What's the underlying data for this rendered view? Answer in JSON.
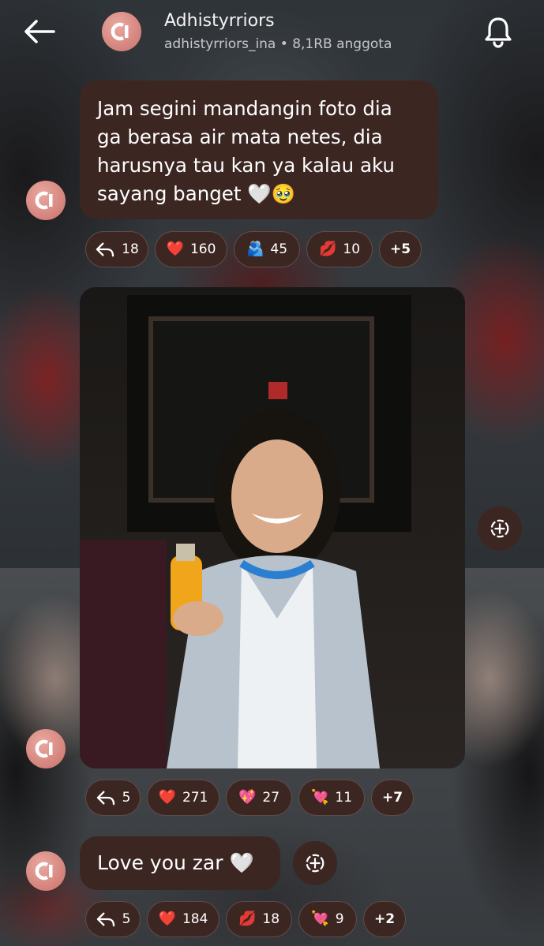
{
  "header": {
    "back_icon": "arrow-left-icon",
    "group_name": "Adhistyrriors",
    "group_meta": "adhistyrriors_ina • 8,1RB anggota",
    "bell_icon": "bell-icon"
  },
  "messages": [
    {
      "text": "Jam segini mandangin foto dia ga berasa air mata netes, dia harusnya tau kan ya kalau aku sayang banget 🤍🥹",
      "reactions": [
        {
          "icon": "reply-icon",
          "count": "18"
        },
        {
          "emoji": "❤️",
          "count": "160"
        },
        {
          "emoji": "🫂",
          "count": "45"
        },
        {
          "emoji": "💋",
          "count": "10"
        }
      ],
      "more": "+5"
    },
    {
      "type": "photo",
      "reactions": [
        {
          "icon": "reply-icon",
          "count": "5"
        },
        {
          "emoji": "❤️",
          "count": "271"
        },
        {
          "emoji": "💖",
          "count": "27"
        },
        {
          "emoji": "💘",
          "count": "11"
        }
      ],
      "more": "+7"
    },
    {
      "text": "Love you zar 🤍",
      "reactions": [
        {
          "icon": "reply-icon",
          "count": "5"
        },
        {
          "emoji": "❤️",
          "count": "184"
        },
        {
          "emoji": "💋",
          "count": "18"
        },
        {
          "emoji": "💘",
          "count": "9"
        }
      ],
      "more": "+2"
    }
  ],
  "colors": {
    "bubble": "#3c2622",
    "accent_avatar": "#d88a82"
  }
}
